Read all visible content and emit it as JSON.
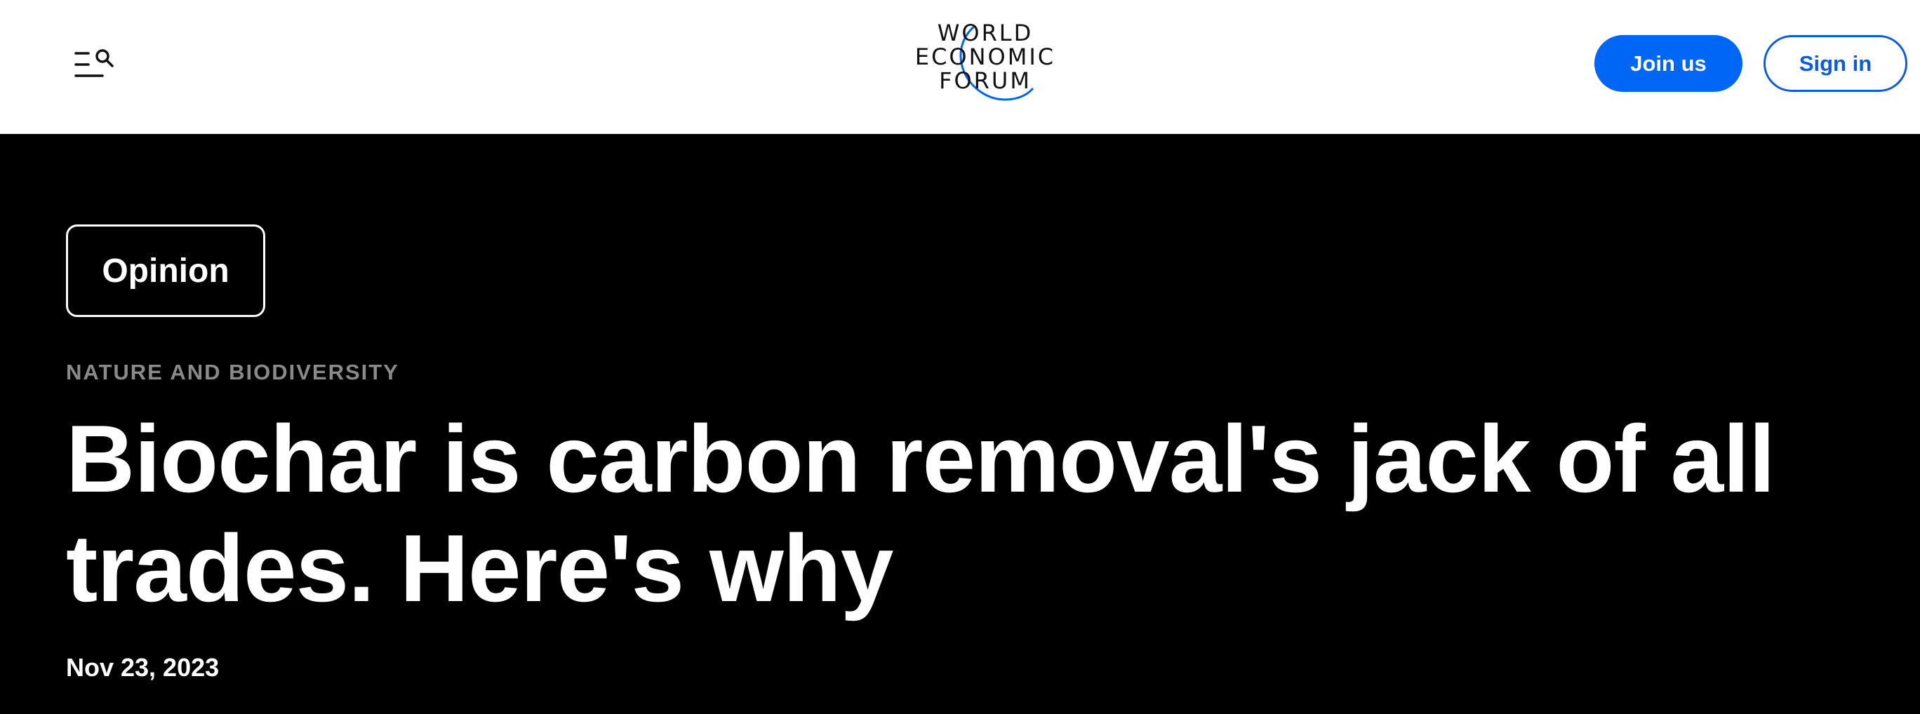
{
  "header": {
    "menu_icon": "menu-search-icon",
    "logo": {
      "line1": "WORLD",
      "line2": "ECONOMIC",
      "line3": "FORUM",
      "arc_color": "#0066f5"
    },
    "join_label": "Join us",
    "signin_label": "Sign in"
  },
  "article": {
    "category_tag": "Opinion",
    "topic": "NATURE AND BIODIVERSITY",
    "title": "Biochar is carbon removal's jack of all trades. Here's why",
    "date": "Nov 23, 2023"
  },
  "colors": {
    "accent": "#0066f5",
    "hero_background": "#000000",
    "topic_text": "#8a8a8a"
  }
}
